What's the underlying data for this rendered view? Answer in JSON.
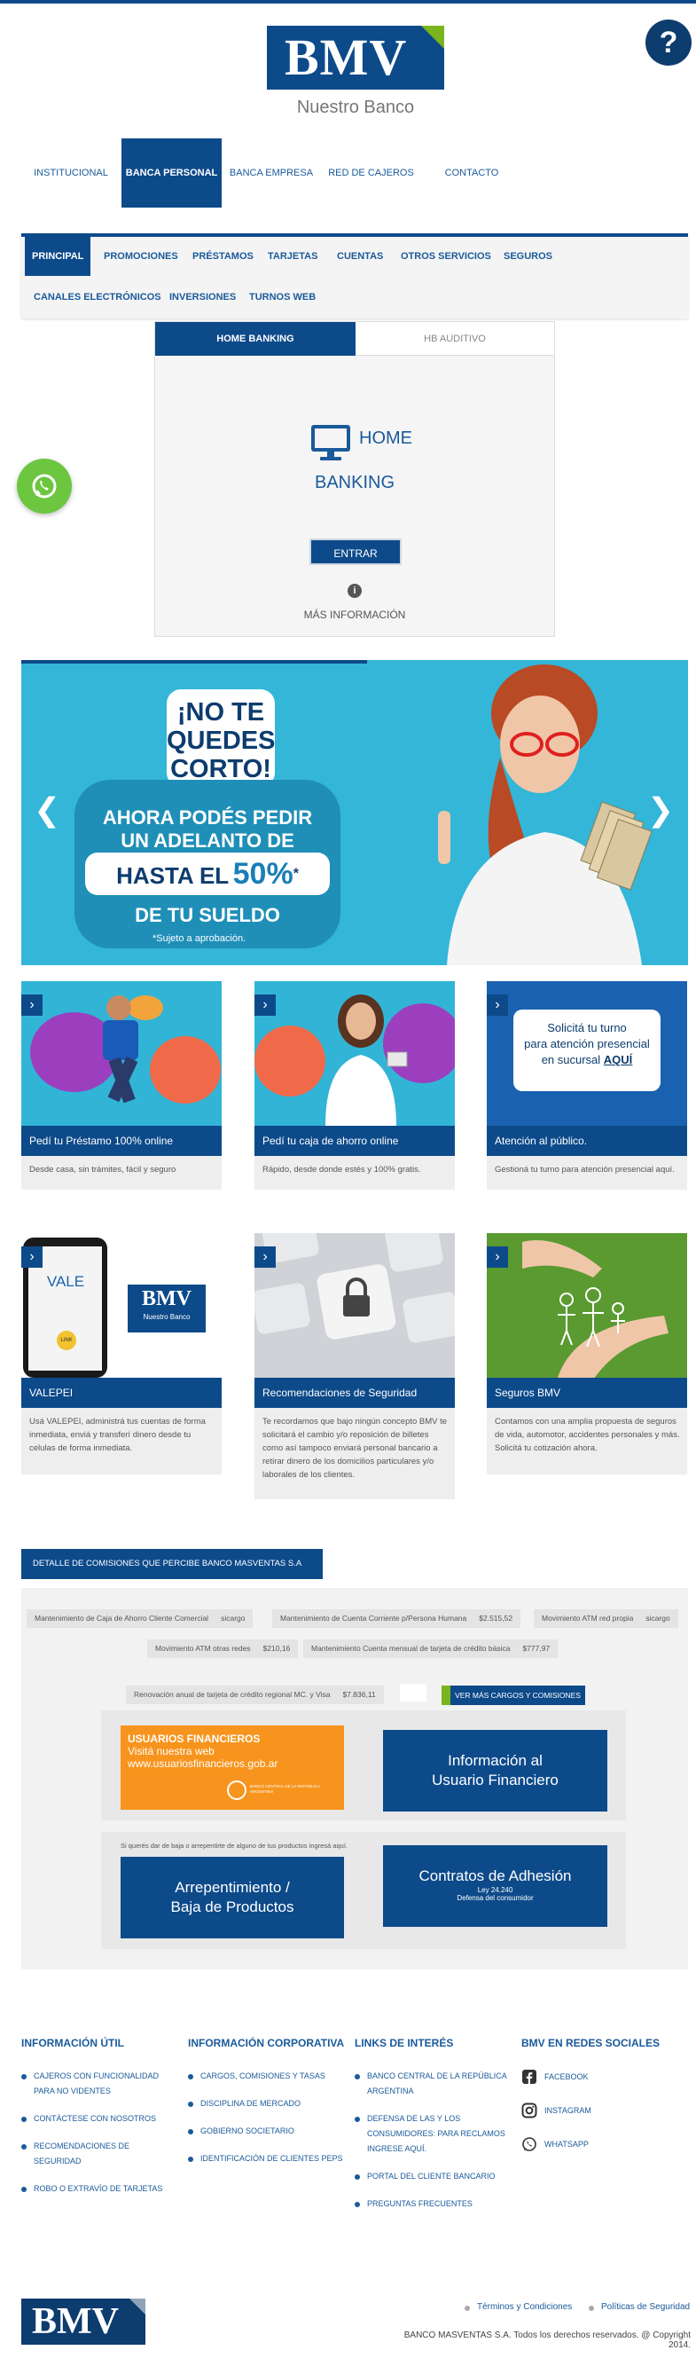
{
  "header": {
    "logo_text": "BMV",
    "tagline": "Nuestro Banco",
    "help_label": "?"
  },
  "top_nav": [
    {
      "label": "INSTITUCIONAL"
    },
    {
      "label": "BANCA PERSONAL"
    },
    {
      "label": "BANCA EMPRESA"
    },
    {
      "label": "RED DE CAJEROS"
    },
    {
      "label": "CONTACTO"
    }
  ],
  "sub_nav": [
    {
      "label": "PRINCIPAL"
    },
    {
      "label": "PROMOCIONES"
    },
    {
      "label": "PRÉSTAMOS"
    },
    {
      "label": "TARJETAS"
    },
    {
      "label": "CUENTAS"
    },
    {
      "label": "OTROS SERVICIOS"
    },
    {
      "label": "SEGUROS"
    },
    {
      "label": "CANALES ELECTRÓNICOS"
    },
    {
      "label": "INVERSIONES"
    },
    {
      "label": "TURNOS WEB"
    }
  ],
  "home_banking": {
    "tab_active": "HOME BANKING",
    "tab_other": "HB AUDITIVO",
    "title_line1": "HOME",
    "title_line2": "BANKING",
    "enter_button": "ENTRAR",
    "more_info": "MÁS INFORMACIÓN"
  },
  "banner": {
    "line1": "¡NO TE",
    "line2": "QUEDES",
    "line3": "CORTO!",
    "promo1": "AHORA PODÉS PEDIR",
    "promo2": "UN ADELANTO DE",
    "promo3a": "HASTA EL",
    "promo3b": "50%",
    "promo3c": "*",
    "promo4": "DE TU SUELDO",
    "note": "*Sujeto a aprobación."
  },
  "cards": [
    {
      "title": "Pedí tu Préstamo 100% online",
      "desc": "Desde casa, sin trámites, fácil y seguro"
    },
    {
      "title": "Pedí tu caja de ahorro online",
      "desc": "Rápido, desde donde estés y 100% gratis."
    },
    {
      "title": "Atención al público.",
      "desc": "Gestioná tu turno para atención presencial aquí.",
      "img_line1": "Solicitá tu turno",
      "img_line2": "para atención presencial",
      "img_line3": "en sucursal",
      "img_line3b": "AQUÍ"
    },
    {
      "title": "VALEPEI",
      "desc": "Usá VALEPEI, administrá tus cuentas de forma inmediata, enviá y transferí dinero desde tu celulas de forma inmediata.",
      "img_vale": "VALE",
      "img_bmv": "BMV",
      "img_sub": "Nuestro Banco",
      "img_link": "LINK"
    },
    {
      "title": "Recomendaciones de Seguridad",
      "desc": "Te recordamos que bajo ningún concepto BMV te solicitará el cambio y/o reposición de billetes como así tampoco enviará personal bancario a retirar dinero de los domicilios particulares y/o laborales de los clientes."
    },
    {
      "title": "Seguros BMV",
      "desc": "Contamos con una amplia propuesta de seguros de vida, automotor, accidentes personales y más. Solicitá tu cotización ahora."
    }
  ],
  "commissions": {
    "button": "DETALLE DE COMISIONES QUE PERCIBE BANCO MASVENTAS S.A",
    "items": [
      {
        "label": "Mantenimiento de Caja de Ahorro Cliente Comercial",
        "value": "sicargo"
      },
      {
        "label": "Mantenimiento de Cuenta Corriente p/Persona Humana",
        "value": "$2.515,52"
      },
      {
        "label": "Movimiento ATM red propia",
        "value": "sicargo"
      },
      {
        "label": "Movimiento ATM otras redes",
        "value": "$210,16"
      },
      {
        "label": "Mantenimiento Cuenta mensual de tarjeta de crédito básica",
        "value": "$777,97"
      },
      {
        "label": "Renovación anual de tarjeta de crédito regional MC. y Visa",
        "value": "$7.836,11"
      }
    ],
    "ver_mas": "VER MÁS CARGOS Y COMISIONES",
    "uf_title": "USUARIOS FINANCIEROS",
    "uf_line": "Visitá nuestra web",
    "uf_url": "www.usuariosfinancieros.gob.ar",
    "uf_seal": "BANCO CENTRAL DE LA REPÚBLICA ARGENTINA",
    "info_line1": "Información al",
    "info_line2": "Usuario Financiero",
    "arrep_note": "Si querés dar de baja o arrepentirte de alguno de tus productos ingresá aquí.",
    "arrep_line1": "Arrepentimiento /",
    "arrep_line2": "Baja de Productos",
    "contr_title": "Contratos de Adhesión",
    "contr_sub1": "Ley 24.240",
    "contr_sub2": "Defensa del consumidor"
  },
  "footer": {
    "col1": {
      "heading": "INFORMACIÓN ÚTIL",
      "items": [
        "CAJEROS CON FUNCIONALIDAD PARA NO VIDENTES",
        "CONTÁCTESE CON NOSOTROS",
        "RECOMENDACIONES DE SEGURIDAD",
        "ROBO O EXTRAVÍO DE TARJETAS"
      ]
    },
    "col2": {
      "heading": "INFORMACIÓN CORPORATIVA",
      "items": [
        "CARGOS, COMISIONES Y TASAS",
        "DISCIPLINA DE MERCADO",
        "GOBIERNO SOCIETARIO",
        "IDENTIFICACIÓN DE CLIENTES PEPS"
      ]
    },
    "col3": {
      "heading": "LINKS DE INTERÉS",
      "items": [
        "BANCO CENTRAL DE LA REPÚBLICA ARGENTINA",
        "DEFENSA DE LAS Y LOS CONSUMIDORES: PARA RECLAMOS INGRESE AQUÍ.",
        "PORTAL DEL CLIENTE BANCARIO",
        "PREGUNTAS FRECUENTES"
      ]
    },
    "col4": {
      "heading": "BMV EN REDES SOCIALES",
      "items": [
        "FACEBOOK",
        "INSTAGRAM",
        "WHATSAPP"
      ]
    },
    "logo_text": "BMV",
    "terms": "Términos y Condiciones",
    "privacy": "Políticas de Seguridad",
    "copyright": "BANCO MASVENTAS S.A. Todos los derechos reservados. @ Copyright 2014."
  },
  "colors": {
    "primary": "#0d4a8a",
    "accent": "#7ab51d",
    "banner": "#33b6d8",
    "whatsapp": "#6cc63f",
    "orange": "#f7941d"
  }
}
